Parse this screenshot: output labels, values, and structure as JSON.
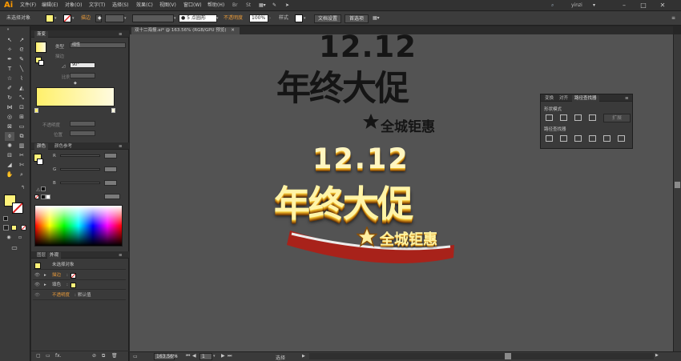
{
  "app": {
    "logo": "Ai",
    "menu": [
      "文件(F)",
      "编辑(E)",
      "对象(O)",
      "文字(T)",
      "选择(S)",
      "效果(C)",
      "视图(V)",
      "窗口(W)",
      "帮助(H)"
    ],
    "user": "yinzi",
    "window_controls": [
      "–",
      "□",
      "✕"
    ]
  },
  "control_bar": {
    "selection_status": "未选择对象",
    "stroke_label": "描边",
    "brush": "● 5 点圆形",
    "opacity_label": "不透明度",
    "opacity_value": "100%",
    "style_label": "样式",
    "doc_setup": "文档设置",
    "preferences": "首选项",
    "fill_color": "#fff27a"
  },
  "document": {
    "tab_title": "双十二海报.ai* @ 163.56% (RGB/GPU 预览)",
    "close": "✕"
  },
  "gradient_panel": {
    "tabs": [
      "渐变"
    ],
    "type_label": "类型",
    "type_value": "线性",
    "stroke_label": "描边",
    "angle_value": "90°",
    "ratio_label": "比例",
    "opacity_label": "不透明度",
    "position_label": "位置",
    "start_color": "#fff06a",
    "end_color": "#fffbe0"
  },
  "color_panel": {
    "tabs": [
      "颜色",
      "颜色参考"
    ],
    "channels": [
      "R",
      "G",
      "B"
    ]
  },
  "appearance_panel": {
    "tabs": [
      "图层",
      "外观"
    ],
    "title": "未选择对象",
    "rows": [
      {
        "label": "描边",
        "value": ""
      },
      {
        "label": "填色",
        "value": ""
      },
      {
        "label": "不透明度",
        "value": "默认值"
      }
    ],
    "stroke_swatch": "#ff3333",
    "fill_swatch": "#fff27a"
  },
  "artwork": {
    "black": {
      "numbers": "12.12",
      "headline": "年终大促",
      "sub": "全城钜惠"
    },
    "gold": {
      "numbers": "12.12",
      "headline": "年终大促",
      "sub": "全城钜惠"
    }
  },
  "pathfinder": {
    "tabs": [
      "变换",
      "对齐",
      "路径查找器"
    ],
    "shape_modes_label": "形状模式",
    "expand_button": "扩展",
    "pathfinders_label": "路径查找器"
  },
  "status_bar": {
    "zoom": "163.56%",
    "page": "1",
    "tool": "选择"
  }
}
